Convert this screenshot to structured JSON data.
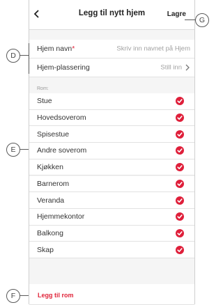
{
  "header": {
    "title": "Legg til nytt hjem",
    "save_label": "Lagre"
  },
  "form": {
    "home_name": {
      "label": "Hjem navn",
      "required_marker": "*",
      "placeholder": "Skriv inn navnet på Hjem"
    },
    "home_location": {
      "label": "Hjem-plassering",
      "value": "Still inn"
    }
  },
  "rooms": {
    "section_label": "Rom:",
    "items": [
      {
        "label": "Stue",
        "checked": true
      },
      {
        "label": "Hovedsoverom",
        "checked": true
      },
      {
        "label": "Spisestue",
        "checked": true
      },
      {
        "label": "Andre soverom",
        "checked": true
      },
      {
        "label": "Kjøkken",
        "checked": true
      },
      {
        "label": "Barnerom",
        "checked": true
      },
      {
        "label": "Veranda",
        "checked": true
      },
      {
        "label": "Hjemmekontor",
        "checked": true
      },
      {
        "label": "Balkong",
        "checked": true
      },
      {
        "label": "Skap",
        "checked": true
      }
    ],
    "add_label": "Legg til rom"
  },
  "callouts": {
    "d": "D",
    "e": "E",
    "f": "F",
    "g": "G"
  },
  "colors": {
    "accent": "#df1f3a",
    "background": "#f5f5f5"
  }
}
